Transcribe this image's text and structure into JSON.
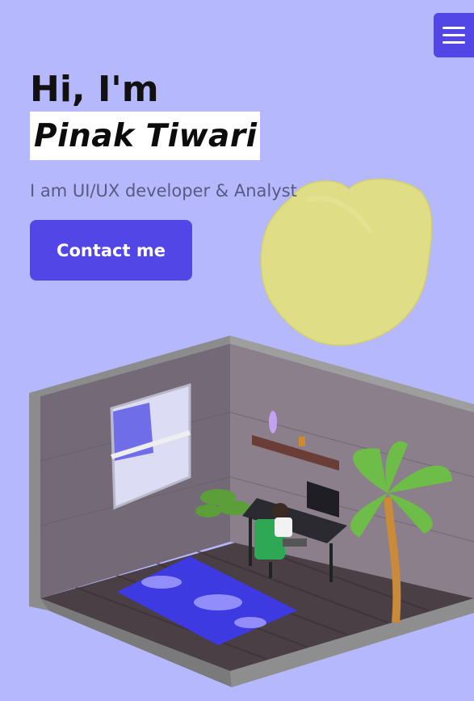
{
  "nav": {
    "menu_icon": "hamburger-menu-icon"
  },
  "hero": {
    "greeting": "Hi, I'm",
    "name": "Pinak Tiwari",
    "tagline": "I am UI/UX developer & Analyst",
    "contact_label": "Contact me"
  },
  "colors": {
    "background": "#b6b8fd",
    "accent": "#5346e6",
    "blob": "#dfdd86",
    "name_highlight": "#ffffff"
  },
  "illustration": {
    "name": "isometric-room-illustration"
  }
}
